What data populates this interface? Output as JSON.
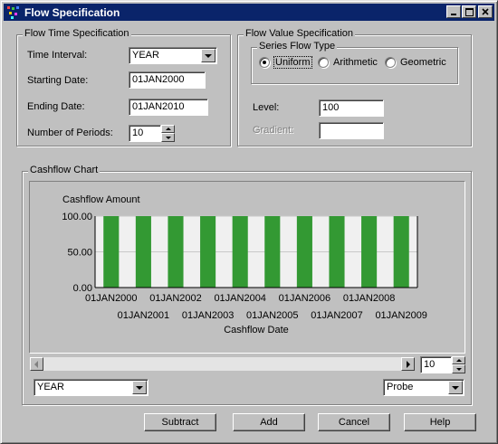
{
  "window": {
    "title": "Flow Specification"
  },
  "time_spec": {
    "legend": "Flow Time Specification",
    "interval_label": "Time Interval:",
    "interval_value": "YEAR",
    "start_label": "Starting Date:",
    "start_value": "01JAN2000",
    "end_label": "Ending Date:",
    "end_value": "01JAN2010",
    "periods_label": "Number of Periods:",
    "periods_value": "10"
  },
  "value_spec": {
    "legend": "Flow Value Specification",
    "series_legend": "Series Flow Type",
    "flow_types": [
      "Uniform",
      "Arithmetic",
      "Geometric"
    ],
    "selected_flow_type": "Uniform",
    "level_label": "Level:",
    "level_value": "100",
    "gradient_label": "Gradient:",
    "gradient_value": ""
  },
  "cashflow": {
    "legend": "Cashflow Chart",
    "zoom_value": "10",
    "interval_select": "YEAR",
    "mode_select": "Probe"
  },
  "chart_data": {
    "type": "bar",
    "ylabel": "Cashflow Amount",
    "xlabel": "Cashflow Date",
    "categories": [
      "01JAN2000",
      "01JAN2001",
      "01JAN2002",
      "01JAN2003",
      "01JAN2004",
      "01JAN2005",
      "01JAN2006",
      "01JAN2007",
      "01JAN2008",
      "01JAN2009"
    ],
    "values": [
      100,
      100,
      100,
      100,
      100,
      100,
      100,
      100,
      100,
      100
    ],
    "ylim": [
      0,
      100
    ],
    "yticks": [
      "0.00",
      "50.00",
      "100.00"
    ],
    "bar_color": "#339933",
    "plot_background": "#f0f0f0",
    "grid": true
  },
  "buttons": {
    "subtract": "Subtract",
    "add": "Add",
    "cancel": "Cancel",
    "help": "Help"
  }
}
